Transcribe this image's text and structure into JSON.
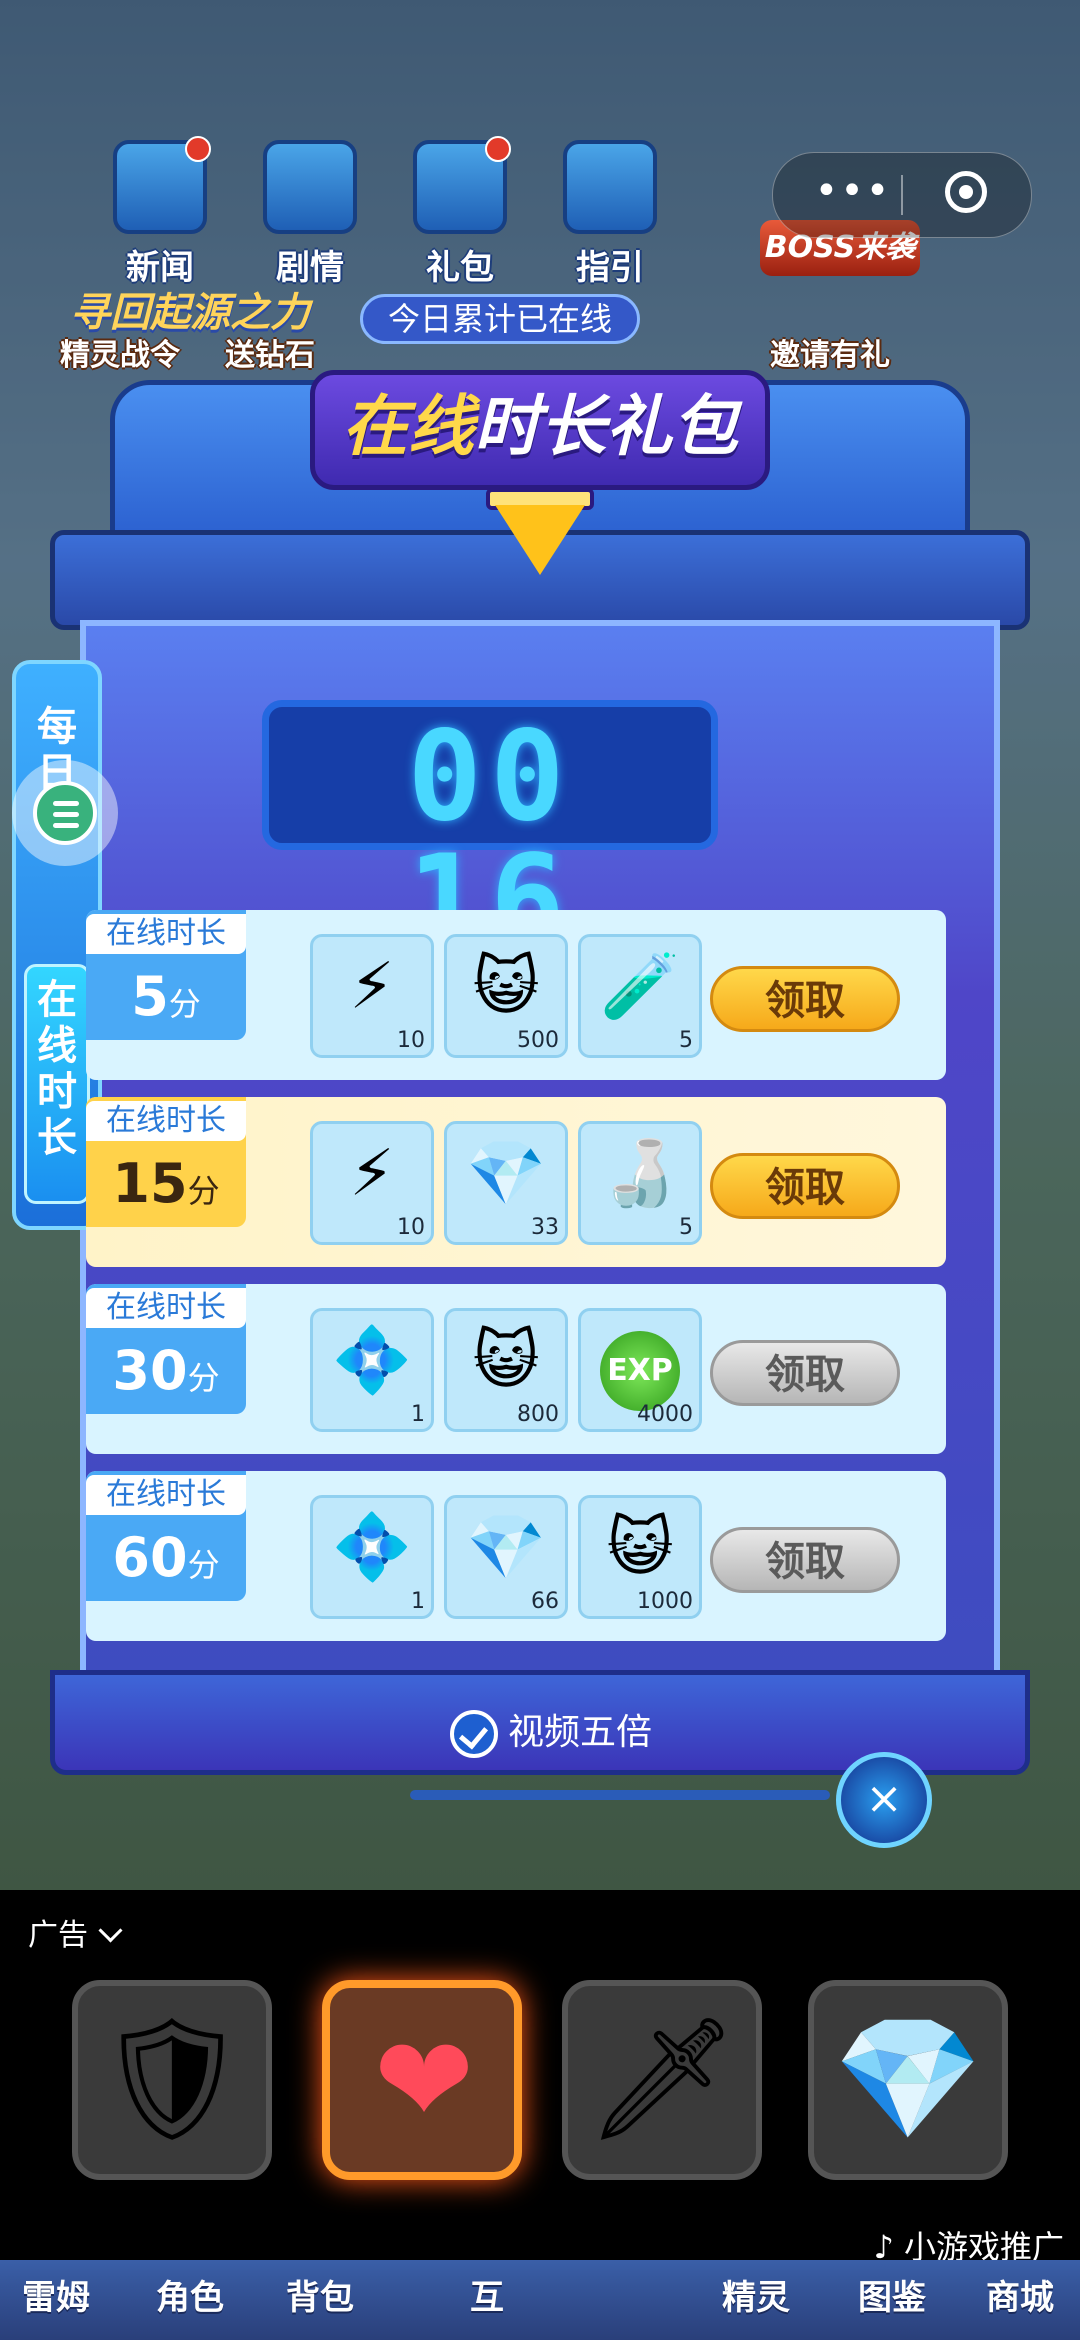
{
  "top_menu": [
    {
      "label": "新闻",
      "badge": true
    },
    {
      "label": "剧情",
      "badge": false
    },
    {
      "label": "礼包",
      "badge": true
    },
    {
      "label": "指引",
      "badge": false
    }
  ],
  "boss_badge": "BOSS来袭",
  "banner_text": "寻回起源之力",
  "second_row": [
    "精灵战令",
    "送钻石",
    "邀请有礼"
  ],
  "capsule": {
    "more": "•••"
  },
  "side_tabs": {
    "top": "每日录",
    "active": "在线时长"
  },
  "panel": {
    "title_highlight": "在线",
    "title_rest": "时长礼包",
    "today_label": "今日累计已在线",
    "timer": "00 16"
  },
  "rows": [
    {
      "tag": "在线时长",
      "minutes": "5",
      "unit": "分",
      "button": "领取",
      "enabled": true,
      "items": [
        {
          "icon": "energy-coin-icon",
          "glyph": "⚡",
          "count": "10"
        },
        {
          "icon": "cat-coin-icon",
          "glyph": "😺",
          "count": "500"
        },
        {
          "icon": "red-potion-icon",
          "glyph": "🧪",
          "count": "5"
        }
      ]
    },
    {
      "tag": "在线时长",
      "minutes": "15",
      "unit": "分",
      "button": "领取",
      "enabled": true,
      "highlight": true,
      "items": [
        {
          "icon": "energy-coin-icon",
          "glyph": "⚡",
          "count": "10"
        },
        {
          "icon": "blue-crystal-icon",
          "glyph": "💎",
          "count": "33"
        },
        {
          "icon": "p-potion-icon",
          "glyph": "🍶",
          "count": "5"
        }
      ]
    },
    {
      "tag": "在线时长",
      "minutes": "30",
      "unit": "分",
      "button": "领取",
      "enabled": false,
      "items": [
        {
          "icon": "crystal-pile-icon",
          "glyph": "💠",
          "count": "1"
        },
        {
          "icon": "cat-coin-icon",
          "glyph": "😺",
          "count": "800"
        },
        {
          "icon": "exp-orb-icon",
          "glyph": "EXP",
          "count": "4000"
        }
      ]
    },
    {
      "tag": "在线时长",
      "minutes": "60",
      "unit": "分",
      "button": "领取",
      "enabled": false,
      "items": [
        {
          "icon": "crystal-pile-icon",
          "glyph": "💠",
          "count": "1"
        },
        {
          "icon": "blue-crystal-icon",
          "glyph": "💎",
          "count": "66"
        },
        {
          "icon": "cat-coin-icon",
          "glyph": "😺",
          "count": "1000"
        }
      ]
    }
  ],
  "video_option": "视频五倍",
  "close_glyph": "×",
  "ad": {
    "label": "广告",
    "slots": [
      {
        "icon": "shield-icon",
        "glyph": "🛡"
      },
      {
        "icon": "heart-icon",
        "glyph": "❤"
      },
      {
        "icon": "sword-icon",
        "glyph": "🗡"
      },
      {
        "icon": "diamond-icon",
        "glyph": "💎"
      }
    ],
    "promo": "♪ 小游戏推广"
  },
  "bottom_nav": [
    "雷姆",
    "角色",
    "背包",
    "互",
    "精灵",
    "图鉴",
    "商城"
  ]
}
